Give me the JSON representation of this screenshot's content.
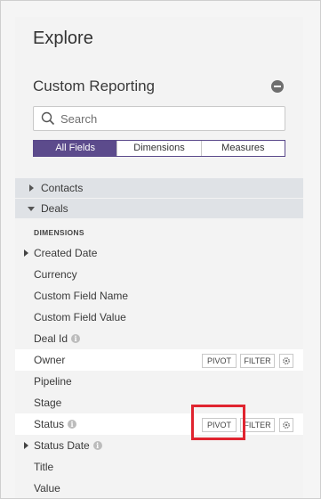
{
  "explore": {
    "title": "Explore"
  },
  "custom_reporting": {
    "title": "Custom Reporting",
    "collapse_icon": "minus-circle-icon"
  },
  "search": {
    "placeholder": "Search",
    "value": ""
  },
  "tabs": [
    {
      "label": "All Fields",
      "active": true
    },
    {
      "label": "Dimensions",
      "active": false
    },
    {
      "label": "Measures",
      "active": false
    }
  ],
  "groups": [
    {
      "label": "Contacts",
      "expanded": false
    },
    {
      "label": "Deals",
      "expanded": true
    }
  ],
  "section_label": "DIMENSIONS",
  "fields": [
    {
      "label": "Created Date",
      "expandable": true,
      "info": false
    },
    {
      "label": "Currency",
      "expandable": false,
      "info": false
    },
    {
      "label": "Custom Field Name",
      "expandable": false,
      "info": false
    },
    {
      "label": "Custom Field Value",
      "expandable": false,
      "info": false
    },
    {
      "label": "Deal Id",
      "expandable": false,
      "info": true
    },
    {
      "label": "Owner",
      "expandable": false,
      "info": false,
      "actions": true
    },
    {
      "label": "Pipeline",
      "expandable": false,
      "info": false
    },
    {
      "label": "Stage",
      "expandable": false,
      "info": false
    },
    {
      "label": "Status",
      "expandable": false,
      "info": true,
      "actions": true
    },
    {
      "label": "Status Date",
      "expandable": true,
      "info": true
    },
    {
      "label": "Title",
      "expandable": false,
      "info": false
    },
    {
      "label": "Value",
      "expandable": false,
      "info": false
    }
  ],
  "actions": {
    "pivot_label": "PIVOT",
    "filter_label": "FILTER",
    "gear_icon": "gear-icon"
  },
  "info_icon_glyph": "i",
  "colors": {
    "accent": "#5c4b8c",
    "highlight": "#e0242f",
    "group_bg": "#dfe2e6"
  }
}
